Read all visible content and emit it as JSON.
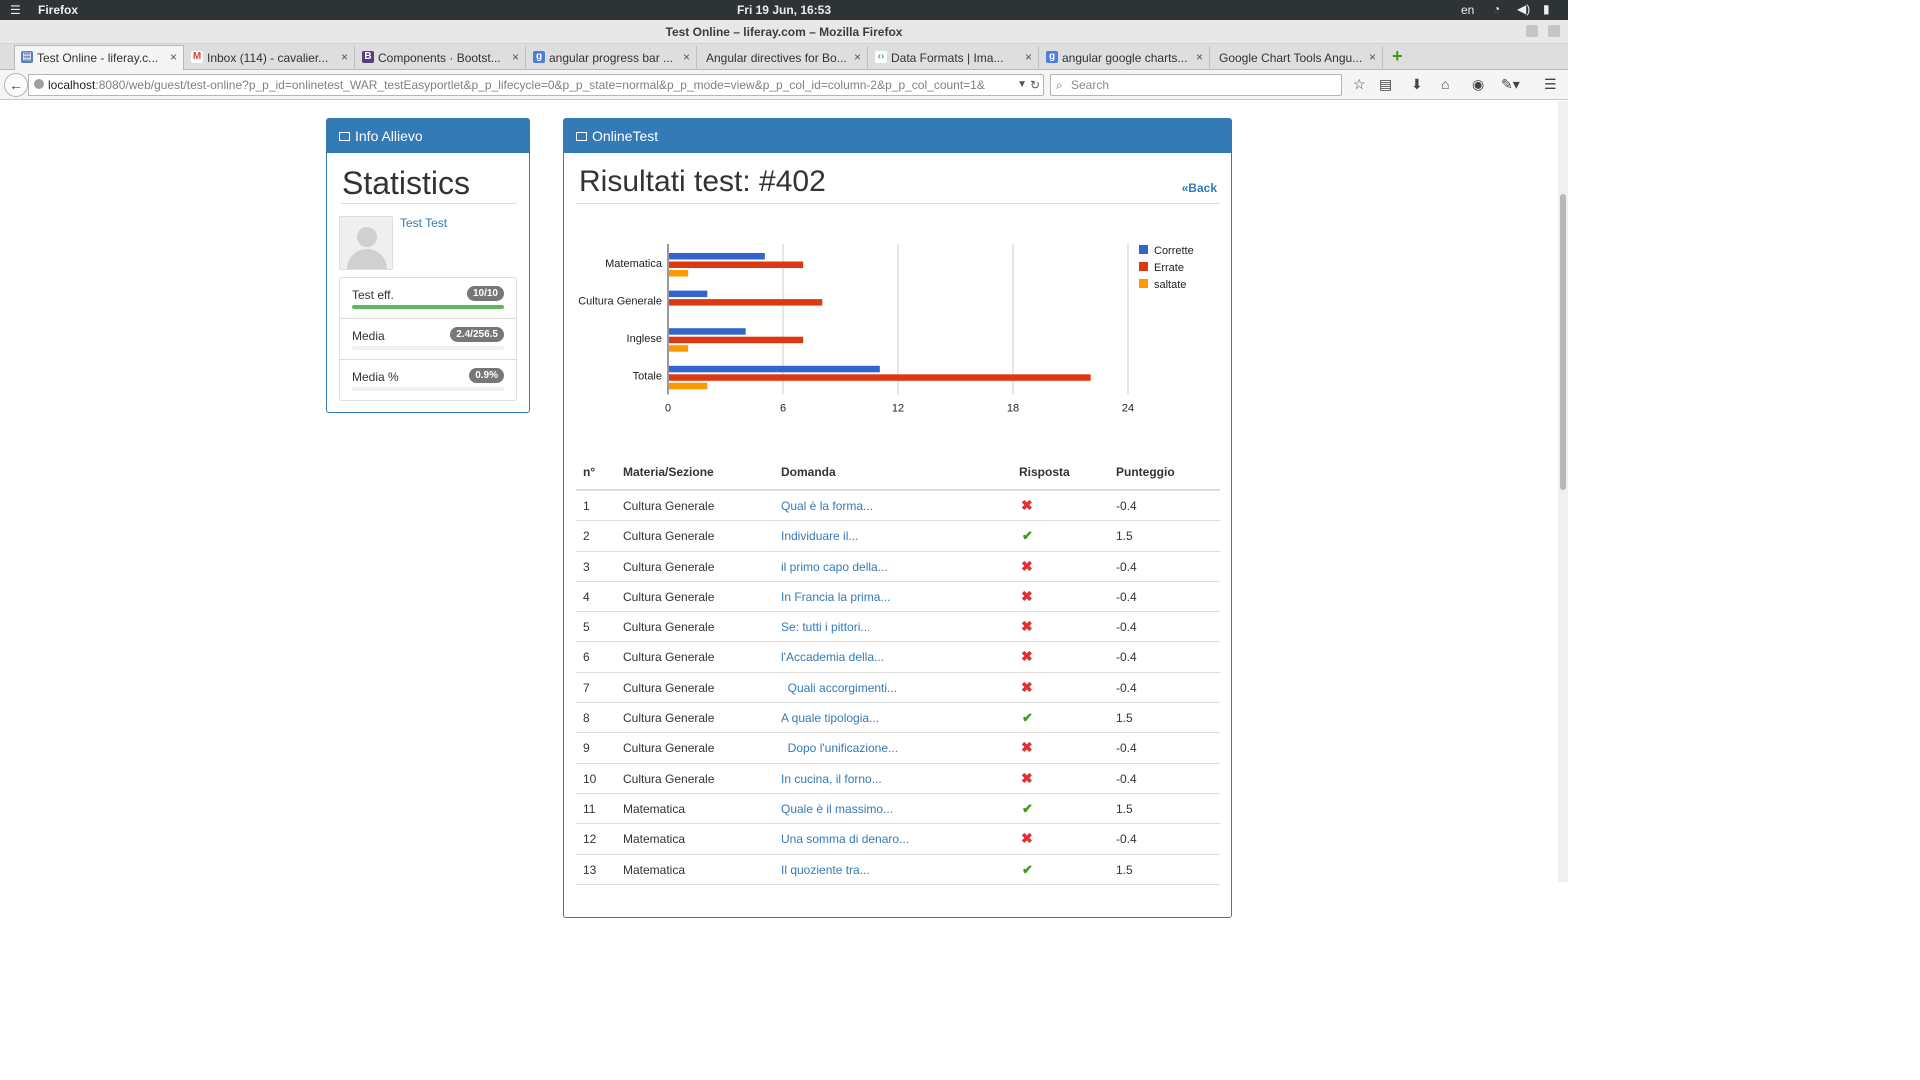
{
  "system": {
    "menu_icon": "hamburger-icon",
    "app_name": "Firefox",
    "clock": "Fri 19 Jun, 16:53",
    "lang": "en"
  },
  "window": {
    "title": "Test Online – liferay.com – Mozilla Firefox"
  },
  "tabs": [
    {
      "label": "Test Online - liferay.c...",
      "favicon": "page-icon",
      "favicon_color": "#5b7fb5",
      "close": "×"
    },
    {
      "label": "Inbox (114) - cavalier...",
      "favicon": "gmail-icon",
      "favicon_color": "#d44638",
      "close": "×"
    },
    {
      "label": "Components · Bootst...",
      "favicon": "bootstrap-icon",
      "favicon_color": "#563d7c",
      "close": "×"
    },
    {
      "label": "angular progress bar ...",
      "favicon": "google-icon",
      "favicon_color": "#4a7fe0",
      "close": "×"
    },
    {
      "label": "Angular directives for Bo...",
      "favicon": "",
      "favicon_color": "",
      "close": "×"
    },
    {
      "label": "Data Formats   |   Ima...",
      "favicon": "google-dev-icon",
      "favicon_color": "#4caf50",
      "close": "×"
    },
    {
      "label": "angular google charts...",
      "favicon": "google-icon",
      "favicon_color": "#4a7fe0",
      "close": "×"
    },
    {
      "label": "Google Chart Tools Angu...",
      "favicon": "",
      "favicon_color": "",
      "close": "×"
    }
  ],
  "navbar": {
    "url_host": "localhost",
    "url_rest": ":8080/web/guest/test-online?p_p_id=onlinetest_WAR_testEasyportlet&p_p_lifecycle=0&p_p_state=normal&p_p_mode=view&p_p_col_id=column-2&p_p_col_count=1&",
    "search_placeholder": "Search"
  },
  "info_panel": {
    "heading": "Info Allievo",
    "title": "Statistics",
    "username": "Test Test",
    "stats": [
      {
        "label": "Test eff.",
        "badge": "10/10",
        "progress": 1.0
      },
      {
        "label": "Media",
        "badge": "2.4/256.5",
        "progress": 0.0
      },
      {
        "label": "Media %",
        "badge": "0.9%",
        "progress": 0.0
      }
    ]
  },
  "test_panel": {
    "heading": "OnlineTest",
    "title": "Risultati test: #402",
    "back_label": "«Back",
    "table": {
      "headers": [
        "n°",
        "Materia/Sezione",
        "Domanda",
        "Risposta",
        "Punteggio"
      ],
      "rows": [
        {
          "n": "1",
          "materia": "Cultura Generale",
          "domanda": "Qual è la forma...",
          "risposta": "wrong",
          "punteggio": "-0.4"
        },
        {
          "n": "2",
          "materia": "Cultura Generale",
          "domanda": "Individuare il...",
          "risposta": "correct",
          "punteggio": "1.5"
        },
        {
          "n": "3",
          "materia": "Cultura Generale",
          "domanda": "il primo capo della...",
          "risposta": "wrong",
          "punteggio": "-0.4"
        },
        {
          "n": "4",
          "materia": "Cultura Generale",
          "domanda": "In Francia la prima...",
          "risposta": "wrong",
          "punteggio": "-0.4"
        },
        {
          "n": "5",
          "materia": "Cultura Generale",
          "domanda": "Se: tutti i pittori...",
          "risposta": "wrong",
          "punteggio": "-0.4"
        },
        {
          "n": "6",
          "materia": "Cultura Generale",
          "domanda": "l'Accademia della...",
          "risposta": "wrong",
          "punteggio": "-0.4"
        },
        {
          "n": "7",
          "materia": "Cultura Generale",
          "domanda": "  Quali accorgimenti...",
          "risposta": "wrong",
          "punteggio": "-0.4"
        },
        {
          "n": "8",
          "materia": "Cultura Generale",
          "domanda": "A quale tipologia...",
          "risposta": "correct",
          "punteggio": "1.5"
        },
        {
          "n": "9",
          "materia": "Cultura Generale",
          "domanda": "  Dopo l'unificazione...",
          "risposta": "wrong",
          "punteggio": "-0.4"
        },
        {
          "n": "10",
          "materia": "Cultura Generale",
          "domanda": "In cucina, il forno...",
          "risposta": "wrong",
          "punteggio": "-0.4"
        },
        {
          "n": "11",
          "materia": "Matematica",
          "domanda": "Quale è il massimo...",
          "risposta": "correct",
          "punteggio": "1.5"
        },
        {
          "n": "12",
          "materia": "Matematica",
          "domanda": "Una somma di denaro...",
          "risposta": "wrong",
          "punteggio": "-0.4"
        },
        {
          "n": "13",
          "materia": "Matematica",
          "domanda": "Il quoziente tra...",
          "risposta": "correct",
          "punteggio": "1.5"
        }
      ]
    }
  },
  "colors": {
    "primary": "#337ab7",
    "corrette": "#3366cc",
    "errate": "#dc3912",
    "saltate": "#ff9900",
    "progress": "#5cb85c"
  },
  "chart_data": {
    "type": "bar",
    "orientation": "horizontal",
    "categories": [
      "Matematica",
      "Cultura Generale",
      "Inglese",
      "Totale"
    ],
    "series": [
      {
        "name": "Corrette",
        "values": [
          5,
          2,
          4,
          11
        ]
      },
      {
        "name": "Errate",
        "values": [
          7,
          8,
          7,
          22
        ]
      },
      {
        "name": "saltate",
        "values": [
          1,
          0,
          1,
          2
        ]
      }
    ],
    "xlim": [
      0,
      24
    ],
    "xticks": [
      "0",
      "6",
      "12",
      "18",
      "24"
    ],
    "grid": true,
    "legend": "right"
  }
}
